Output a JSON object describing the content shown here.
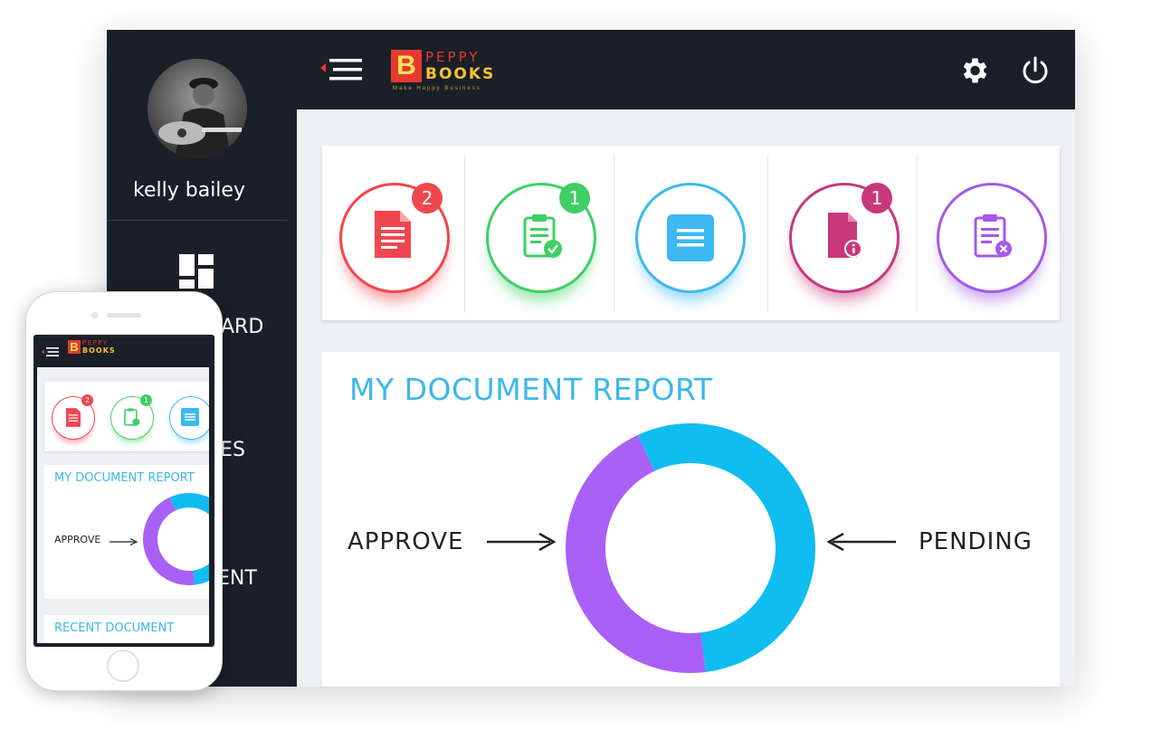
{
  "user": {
    "name": "kelly bailey"
  },
  "sidebar": {
    "items": [
      {
        "label": "ARD"
      },
      {
        "label": "GES"
      },
      {
        "label": "ENT"
      }
    ]
  },
  "brand": {
    "letter": "B",
    "line1": "PEPPY",
    "line2": "BOOKS",
    "tagline": "Make Happy Business"
  },
  "status_items": [
    {
      "icon": "document-icon",
      "color": "#f0474f",
      "badge": "2"
    },
    {
      "icon": "clipboard-check-icon",
      "color": "#3fcf66",
      "badge": "1"
    },
    {
      "icon": "list-icon",
      "color": "#3bb9f0",
      "badge": ""
    },
    {
      "icon": "file-info-icon",
      "color": "#c8387a",
      "badge": "1"
    },
    {
      "icon": "clipboard-cancel-icon",
      "color": "#a45ae8",
      "badge": ""
    }
  ],
  "report": {
    "title": "MY DOCUMENT REPORT",
    "approve_label": "APPROVE",
    "pending_label": "PENDING"
  },
  "chart_data": {
    "type": "pie",
    "categories": [
      "APPROVE",
      "PENDING"
    ],
    "values": [
      45,
      55
    ],
    "colors": [
      "#a960f7",
      "#0fbdf1"
    ]
  },
  "phone": {
    "report_title": "MY DOCUMENT REPORT",
    "approve_label": "APPROVE",
    "recent_title": "RECENT DOCUMENT",
    "badges": [
      "2",
      "1"
    ]
  }
}
